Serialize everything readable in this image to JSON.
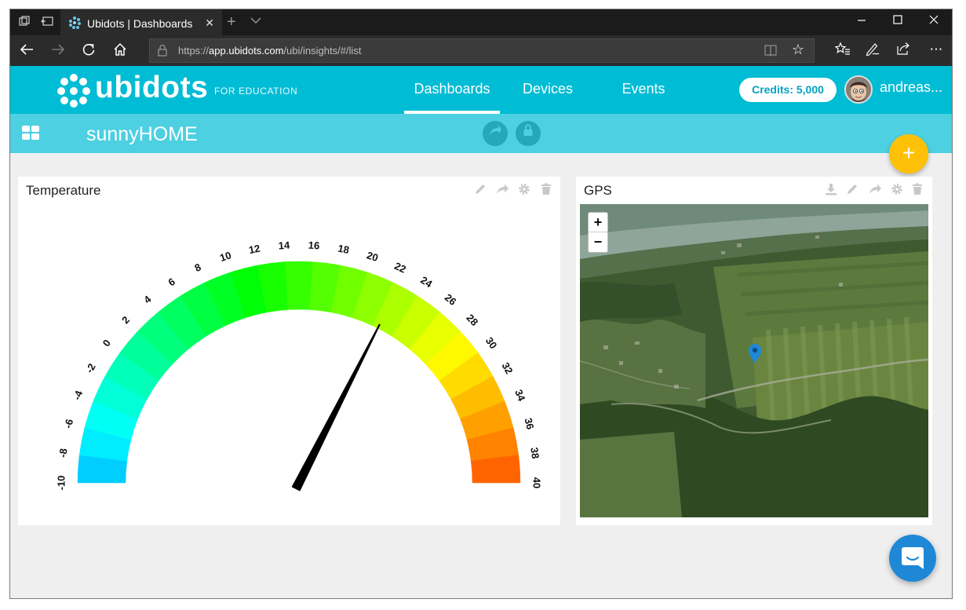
{
  "browser": {
    "tab_title": "Ubidots | Dashboards",
    "url_prefix": "https://",
    "url_host": "app.ubidots.com",
    "url_path": "/ubi/insights/#/list"
  },
  "app": {
    "logo_text": "ubidots",
    "edu_label": "FOR EDUCATION",
    "nav": {
      "dashboards": "Dashboards",
      "devices": "Devices",
      "events": "Events"
    },
    "credits": "Credits: 5,000",
    "username": "andreas..."
  },
  "dashboard": {
    "title": "sunnyHOME",
    "add_icon": "+"
  },
  "widgets": {
    "temperature": {
      "title": "Temperature",
      "gauge": {
        "min": -10,
        "max": 40,
        "tick_step": 2,
        "ticks": [
          "-10",
          "-8",
          "-6",
          "-4",
          "-2",
          "0",
          "2",
          "4",
          "6",
          "8",
          "10",
          "12",
          "14",
          "16",
          "18",
          "20",
          "22",
          "24",
          "26",
          "28",
          "30",
          "32",
          "34",
          "36",
          "38",
          "40"
        ],
        "value": 22.5
      }
    },
    "gps": {
      "title": "GPS",
      "zoom_in": "+",
      "zoom_out": "−"
    }
  },
  "colors": {
    "header": "#00bcd4",
    "subheader": "#4dd0e1",
    "fab": "#ffc107",
    "chat": "#1e88d6",
    "marker": "#1e88d6"
  }
}
